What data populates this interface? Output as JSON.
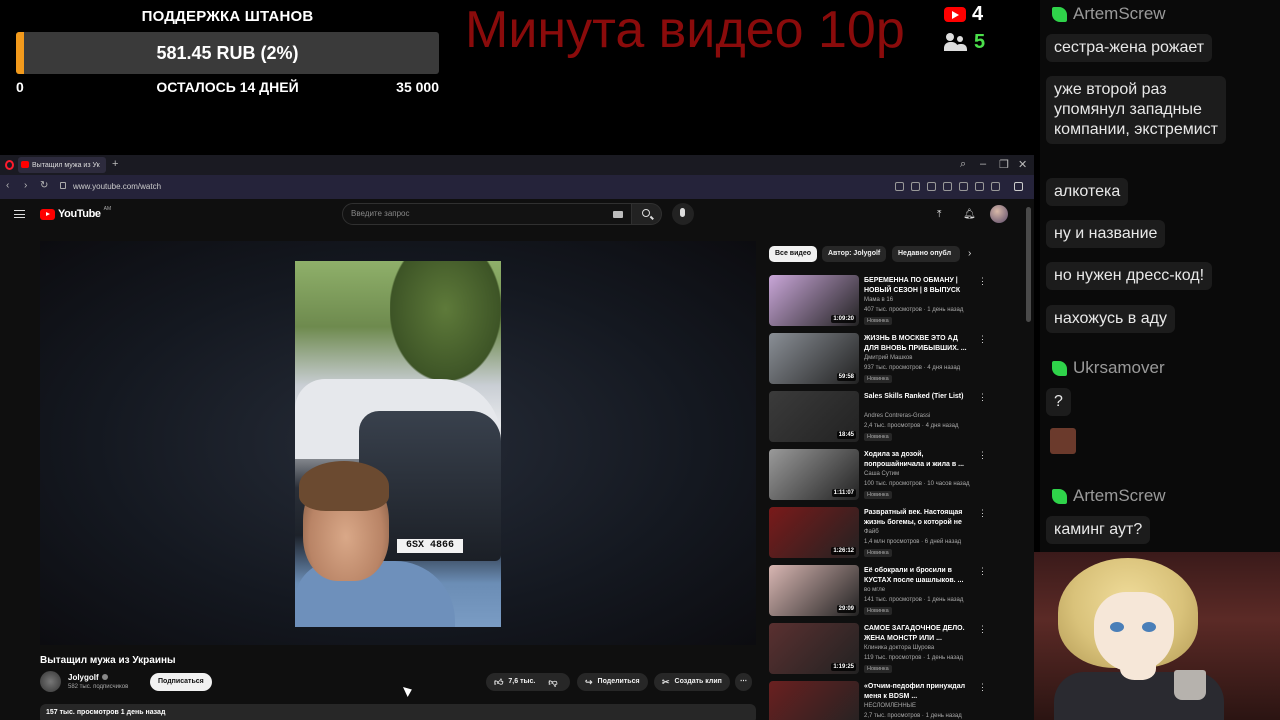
{
  "overlay": {
    "donation": {
      "title": "ПОДДЕРЖКА ШТАНОВ",
      "amount": "581.45 RUB (2%)",
      "progress_percent": 2,
      "min": "0",
      "remaining": "ОСТАЛОСЬ 14 ДНЕЙ",
      "max": "35 000",
      "fill_color": "#f29a1c"
    },
    "promo_text": "Минута видео 10р",
    "stats": {
      "youtube_count": "4",
      "viewers_count": "5"
    }
  },
  "chat": {
    "messages": [
      {
        "user": "ArtemScrew",
        "text": "сестра-жена рожает"
      },
      {
        "text": "уже второй раз упомянул западные компании, экстремист"
      },
      {
        "text": "алкотека"
      },
      {
        "text": "ну и название"
      },
      {
        "text": "но нужен дресс-код!"
      },
      {
        "text": "нахожусь в аду"
      },
      {
        "user": "Ukrsamover",
        "text": "?"
      },
      {
        "user": "ArtemScrew",
        "text": "каминг аут?"
      }
    ]
  },
  "browser": {
    "tab_title": "Вытащил мужа из Ук",
    "url": "www.youtube.com/watch"
  },
  "youtube": {
    "logo_text": "YouTube",
    "logo_country": "AM",
    "search_placeholder": "Введите запрос",
    "video": {
      "plate": "6SX 4866",
      "title": "Вытащил мужа из Украины",
      "channel": "Jolygolf",
      "subscribers": "582 тыс. подписчиков",
      "subscribe_label": "Подписаться",
      "likes": "7,6 тыс.",
      "share_label": "Поделиться",
      "clip_label": "Создать клип",
      "views_date": "157 тыс. просмотров  1 день назад"
    },
    "chips": [
      "Все видео",
      "Автор: Jolygolf",
      "Недавно опубл"
    ],
    "related": [
      {
        "title": "БЕРЕМЕННА ПО ОБМАНУ | НОВЫЙ СЕЗОН | 8 ВЫПУСК",
        "channel": "Мама в 16",
        "meta": "407 тыс. просмотров · 1 день назад",
        "duration": "1:09:20",
        "badge": "Новинка",
        "thumb": "#c9a6d8"
      },
      {
        "title": "ЖИЗНЬ В МОСКВЕ ЭТО АД ДЛЯ ВНОВЬ ПРИБЫВШИХ. ...",
        "channel": "Дмитрий Машков",
        "meta": "937 тыс. просмотров · 4 дня назад",
        "duration": "59:58",
        "badge": "Новинка",
        "thumb": "#8a8f96"
      },
      {
        "title": "Sales Skills Ranked (Tier List)",
        "channel": "Andres Contreras-Grassi",
        "meta": "2,4 тыс. просмотров · 4 дня назад",
        "duration": "18:45",
        "badge": "Новинка",
        "thumb": "#3b3b3b"
      },
      {
        "title": "Ходила за дозой, попрошайничала и жила в ...",
        "channel": "Саша Сутим",
        "meta": "100 тыс. просмотров · 10 часов назад",
        "duration": "1:11:07",
        "badge": "Новинка",
        "thumb": "#9a9a9a"
      },
      {
        "title": "Развратный век. Настоящая жизнь богемы, о которой не ...",
        "channel": "Файб",
        "meta": "1,4 млн просмотров · 6 дней назад",
        "duration": "1:26:12",
        "badge": "Новинка",
        "thumb": "#7a1a1a"
      },
      {
        "title": "Её обокрали и бросили в КУСТАХ после шашлыков. ...",
        "channel": "во мгле",
        "meta": "141 тыс. просмотров · 1 день назад",
        "duration": "29:09",
        "badge": "Новинка",
        "thumb": "#d8b6b2"
      },
      {
        "title": "САМОЕ ЗАГАДОЧНОЕ ДЕЛО. ЖЕНА МОНСТР ИЛИ ...",
        "channel": "Клиника доктора Шурова",
        "meta": "119 тыс. просмотров · 1 день назад",
        "duration": "1:19:25",
        "badge": "Новинка",
        "thumb": "#5a3030"
      },
      {
        "title": "«Отчим-педофил принуждал меня к BDSM ...",
        "channel": "НЕСЛОМЛЕННЫЕ",
        "meta": "2,7 тыс. просмотров · 1 день назад",
        "duration": "",
        "badge": "",
        "thumb": "#6a2020"
      }
    ]
  }
}
